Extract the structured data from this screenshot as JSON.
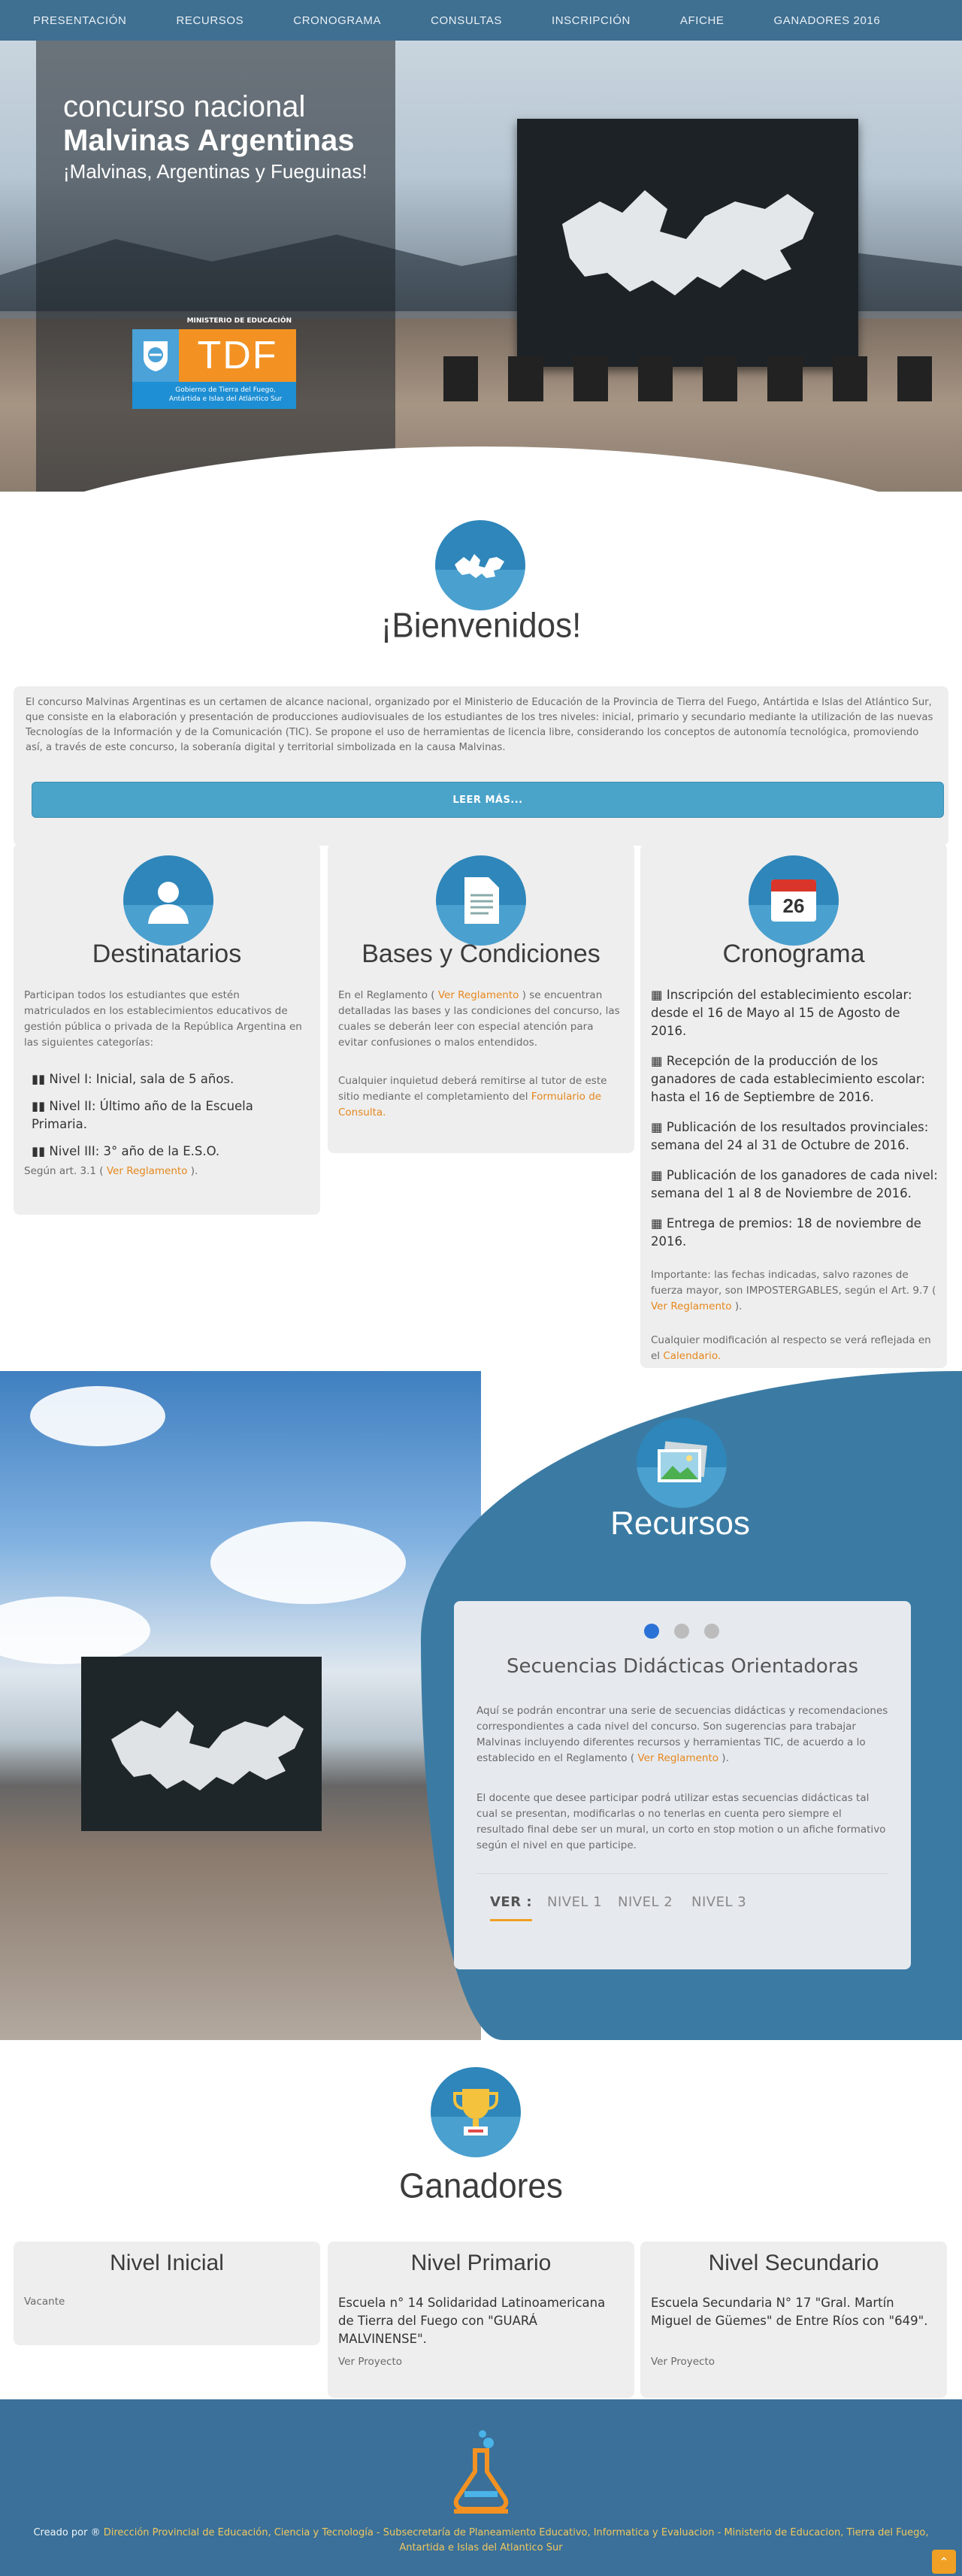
{
  "nav": {
    "items": [
      "PRESENTACIÓN",
      "RECURSOS",
      "CRONOGRAMA",
      "CONSULTAS",
      "INSCRIPCIÓN",
      "AFICHE",
      "GANADORES 2016"
    ]
  },
  "hero": {
    "line1": "concurso nacional",
    "line2": "Malvinas Argentinas",
    "line3": "¡Malvinas, Argentinas y Fueguinas!",
    "logo_top": "MINISTERIO DE EDUCACIÓN",
    "logo_main": "TDF",
    "logo_sub": "Gobierno de Tierra del Fuego, Antártida e Islas del Atlántico Sur"
  },
  "welcome": {
    "title": "¡Bienvenidos!",
    "body": "El concurso Malvinas Argentinas es un certamen de alcance nacional, organizado por el Ministerio de Educación de la Provincia de Tierra del Fuego, Antártida e Islas del Atlántico Sur, que consiste en la elaboración y presentación de producciones audiovisuales de los estudiantes de los tres niveles: inicial, primario y secundario mediante la utilización de las nuevas Tecnologías de la Información y de la Comunicación (TIC). Se propone el uso de herramientas de licencia libre, considerando los conceptos de autonomía tecnológica, promoviendo así, a través de este concurso, la soberanía digital y territorial simbolizada en la causa Malvinas.",
    "read_more": "LEER MÁS..."
  },
  "destinatarios": {
    "title": "Destinatarios",
    "intro": "Participan todos los estudiantes que estén matriculados en los establecimientos educativos de gestión pública o privada de la República Argentina en las siguientes categorías:",
    "levels": [
      "Nivel I: Inicial, sala de 5 años.",
      "Nivel II: Último año de la Escuela Primaria.",
      "Nivel III: 3° año de la E.S.O."
    ],
    "note_prefix": "Según art. 3.1 (",
    "note_link": "Ver Reglamento",
    "note_suffix": ")."
  },
  "bases": {
    "title": "Bases y Condiciones",
    "p1_prefix": "En el Reglamento (",
    "p1_link": "Ver Reglamento",
    "p1_suffix": ") se encuentran detalladas las bases y las condiciones del concurso, las cuales se deberán leer con especial atención para evitar confusiones o malos entendidos.",
    "p2_prefix": "Cualquier inquietud deberá remitirse al tutor de este sitio mediante el completamiento del",
    "p2_link": "Formulario de Consulta."
  },
  "cronograma": {
    "title": "Cronograma",
    "calendar_day": "26",
    "items": [
      "Inscripción del establecimiento escolar: desde el 16 de Mayo al 15 de Agosto de 2016.",
      "Recepción de la producción de los ganadores de cada establecimiento escolar: hasta el 16 de Septiembre de 2016.",
      "Publicación de los resultados provinciales: semana del 24 al 31 de Octubre de 2016.",
      "Publicación de los ganadores de cada nivel: semana del 1 al 8 de Noviembre de 2016.",
      "Entrega de premios: 18 de noviembre de 2016."
    ],
    "important_prefix": "Importante: las fechas indicadas, salvo razones de fuerza mayor, son IMPOSTERGABLES, según el Art. 9.7 (",
    "important_link": "Ver Reglamento",
    "important_suffix": ").",
    "modif_prefix": "Cualquier modificación al respecto se verá reflejada en el",
    "modif_link": "Calendario."
  },
  "recursos": {
    "title": "Recursos",
    "card_title": "Secuencias Didácticas Orientadoras",
    "p1_prefix": "Aquí se podrán encontrar una serie de secuencias didácticas y recomendaciones correspondientes a cada nivel del concurso. Son sugerencias para trabajar Malvinas incluyendo diferentes recursos y herramientas TIC, de acuerdo a lo establecido en el Reglamento (",
    "p1_link": "Ver Reglamento",
    "p1_suffix": ").",
    "p2": "El docente que desee participar podrá utilizar estas secuencias didácticas tal cual se presentan, modificarlas o no tenerlas en cuenta pero siempre el resultado final debe ser un mural, un corto en stop motion o un afiche formativo según el nivel en que participe.",
    "tabs": [
      "VER :",
      "NIVEL 1",
      "NIVEL 2",
      "NIVEL 3"
    ]
  },
  "ganadores": {
    "title": "Ganadores",
    "inicial_title": "Nivel Inicial",
    "inicial_text": "Vacante",
    "primario_title": "Nivel Primario",
    "primario_text": "Escuela n° 14 Solidaridad Latinoamericana de Tierra del Fuego con \"GUARÁ MALVINENSE\".",
    "primario_link": "Ver Proyecto",
    "secundario_title": "Nivel Secundario",
    "secundario_text": "Escuela Secundaria N° 17 \"Gral. Martín Miguel de Güemes\" de Entre Ríos con \"649\".",
    "secundario_link": "Ver Proyecto"
  },
  "footer": {
    "by": "Creado por ® ",
    "credits": "Dirección Provincial de Educación, Ciencia y Tecnología - Subsecretaría de Planeamiento Educativo, Informatica y Evaluacion - Ministerio de Educacion, Tierra del Fuego, Antartida e Islas del Atlantico Sur"
  },
  "colors": {
    "nav": "#3f6f91",
    "accent_blue": "#2e86ba",
    "link_orange": "#e6871c",
    "footer": "#3a7099"
  }
}
